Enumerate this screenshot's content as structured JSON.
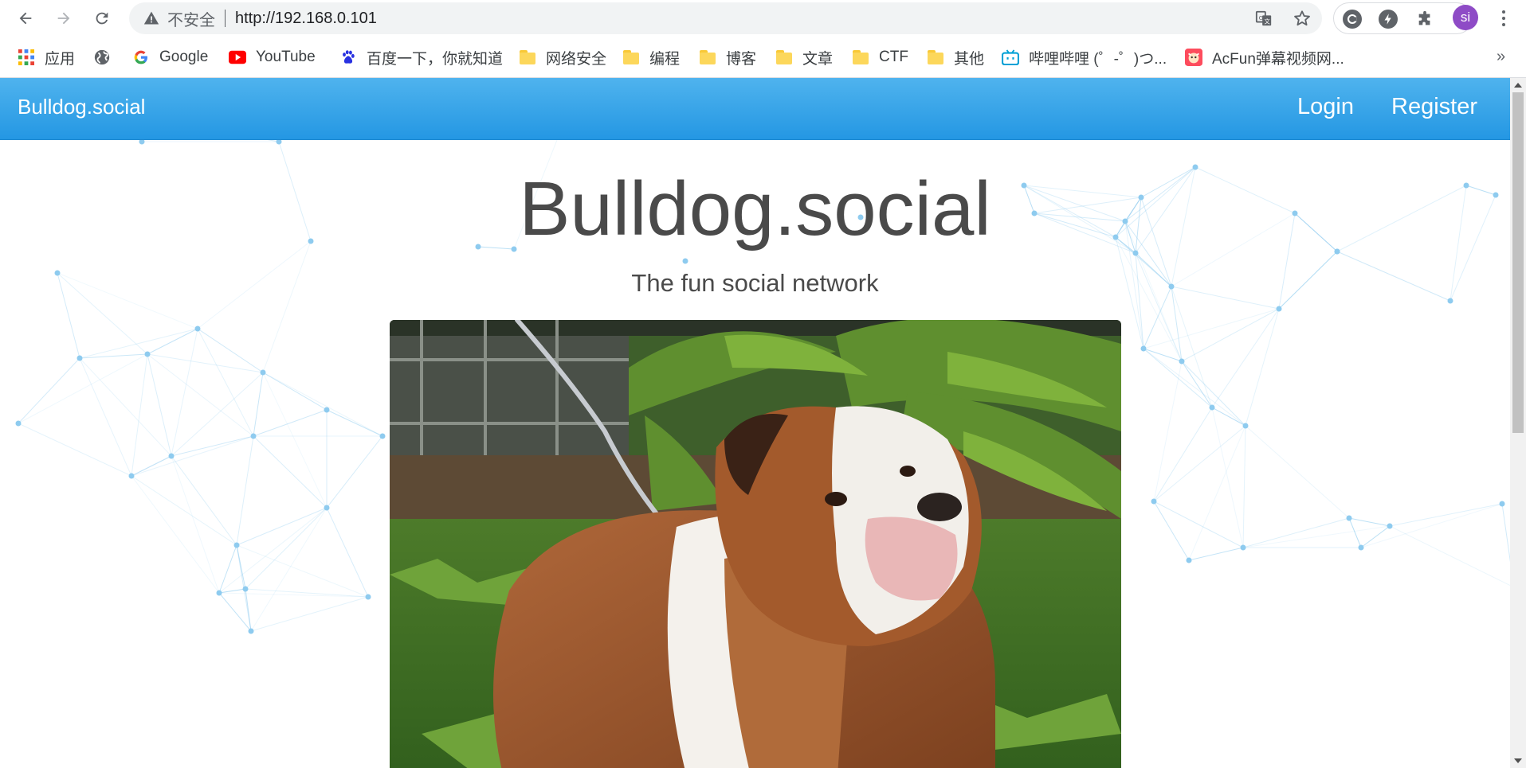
{
  "browser": {
    "insecure_label": "不安全",
    "url": "http://192.168.0.101",
    "avatar_initials": "si",
    "icons": [
      "back-arrow-icon",
      "forward-arrow-icon",
      "reload-icon",
      "warning-icon",
      "translate-icon",
      "star-icon",
      "extension-c-icon",
      "extension-bolt-icon",
      "puzzle-icon",
      "menu-dots-icon"
    ]
  },
  "bookmarks": {
    "items": [
      {
        "label": "应用",
        "icon": "apps-grid-icon"
      },
      {
        "label": "",
        "icon": "globe-icon"
      },
      {
        "label": "Google",
        "icon": "google-icon"
      },
      {
        "label": "YouTube",
        "icon": "youtube-icon"
      },
      {
        "label": "百度一下，你就知道",
        "icon": "baidu-paw-icon"
      },
      {
        "label": "网络安全",
        "icon": "folder-icon"
      },
      {
        "label": "编程",
        "icon": "folder-icon"
      },
      {
        "label": "博客",
        "icon": "folder-icon"
      },
      {
        "label": "文章",
        "icon": "folder-icon"
      },
      {
        "label": "CTF",
        "icon": "folder-icon"
      },
      {
        "label": "其他",
        "icon": "folder-icon"
      },
      {
        "label": "哔哩哔哩 (゜-゜)つ...",
        "icon": "bilibili-icon"
      },
      {
        "label": "AcFun弹幕视频网...",
        "icon": "acfun-icon"
      }
    ],
    "more": "»"
  },
  "site": {
    "brand": "Bulldog.social",
    "nav": {
      "login": "Login",
      "register": "Register"
    },
    "hero_title": "Bulldog.social",
    "hero_subtitle": "The fun social network",
    "colors": {
      "nav_top": "#4fb3ee",
      "nav_bottom": "#2497e3",
      "text": "#4a4a4a",
      "plexus": "#8ecbef"
    }
  }
}
